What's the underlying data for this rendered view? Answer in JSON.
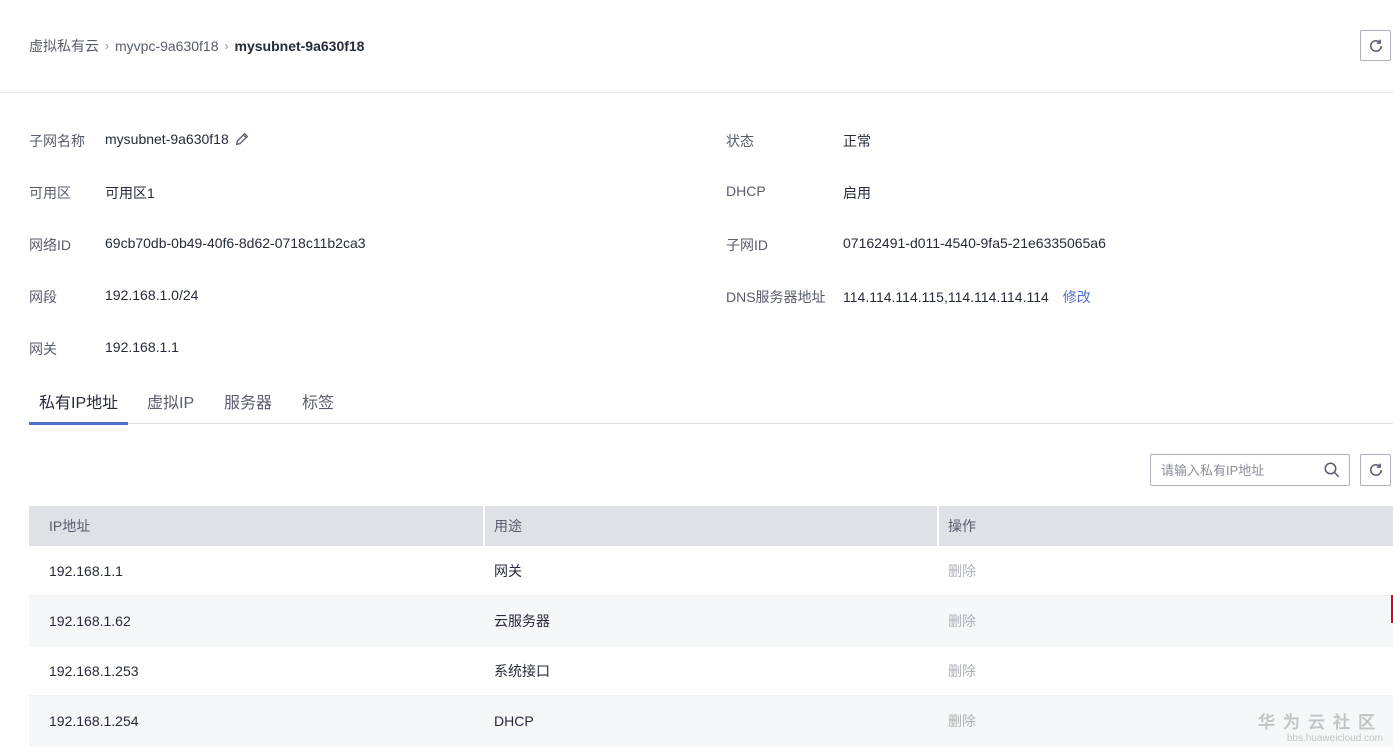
{
  "breadcrumb": {
    "items": [
      "虚拟私有云",
      "myvpc-9a630f18",
      "mysubnet-9a630f18"
    ],
    "separator": "›"
  },
  "details": {
    "subnet_name_label": "子网名称",
    "subnet_name_value": "mysubnet-9a630f18",
    "az_label": "可用区",
    "az_value": "可用区1",
    "network_id_label": "网络ID",
    "network_id_value": "69cb70db-0b49-40f6-8d62-0718c11b2ca3",
    "cidr_label": "网段",
    "cidr_value": "192.168.1.0/24",
    "gateway_label": "网关",
    "gateway_value": "192.168.1.1",
    "status_label": "状态",
    "status_value": "正常",
    "dhcp_label": "DHCP",
    "dhcp_value": "启用",
    "subnet_id_label": "子网ID",
    "subnet_id_value": "07162491-d011-4540-9fa5-21e6335065a6",
    "dns_label": "DNS服务器地址",
    "dns_value": "114.114.114.115,114.114.114.114",
    "dns_modify_link": "修改"
  },
  "tabs": [
    {
      "label": "私有IP地址",
      "active": true
    },
    {
      "label": "虚拟IP",
      "active": false
    },
    {
      "label": "服务器",
      "active": false
    },
    {
      "label": "标签",
      "active": false
    }
  ],
  "search": {
    "placeholder": "请输入私有IP地址",
    "value": ""
  },
  "table": {
    "columns": [
      "IP地址",
      "用途",
      "操作"
    ],
    "rows": [
      {
        "ip": "192.168.1.1",
        "usage": "网关",
        "action": "删除"
      },
      {
        "ip": "192.168.1.62",
        "usage": "云服务器",
        "action": "删除"
      },
      {
        "ip": "192.168.1.253",
        "usage": "系统接口",
        "action": "删除"
      },
      {
        "ip": "192.168.1.254",
        "usage": "DHCP",
        "action": "删除"
      }
    ]
  },
  "watermark": {
    "main": "华为云社区",
    "sub": "bbs.huaweicloud.com"
  },
  "colors": {
    "link": "#526ecc",
    "tab_active": "#526ecc",
    "table_header_bg": "#dfe1e6",
    "disabled_link": "#adb0b8"
  },
  "icons": {
    "refresh": "refresh-icon",
    "edit": "pencil-icon",
    "search": "search-icon"
  }
}
